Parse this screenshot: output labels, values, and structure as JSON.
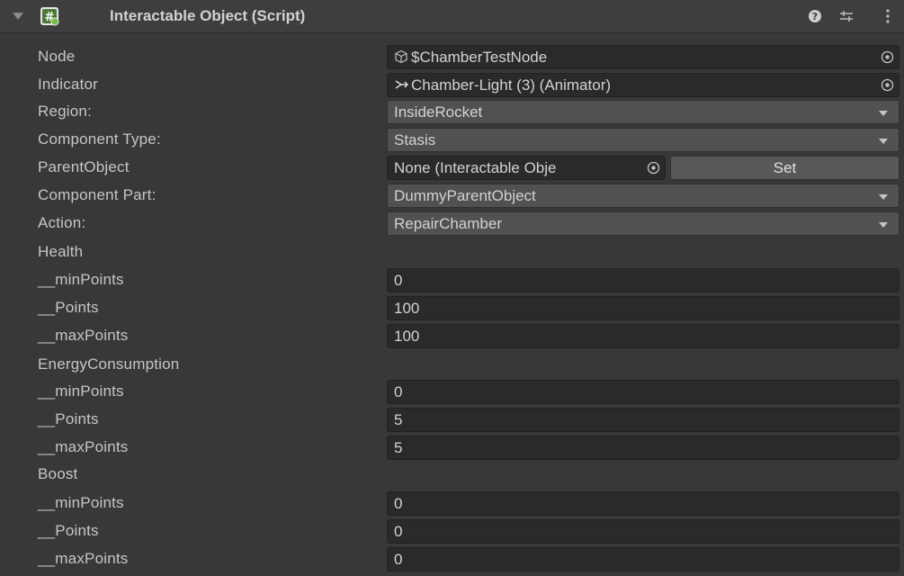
{
  "header": {
    "title": "Interactable Object (Script)"
  },
  "fields": {
    "node": {
      "label": "Node",
      "value": "$ChamberTestNode"
    },
    "indicator": {
      "label": "Indicator",
      "value": "Chamber-Light (3) (Animator)"
    },
    "region": {
      "label": "Region:",
      "value": "InsideRocket"
    },
    "component_type": {
      "label": "Component Type:",
      "value": "Stasis"
    },
    "parent_object": {
      "label": "ParentObject",
      "value": "None (Interactable Obje",
      "button": "Set"
    },
    "component_part": {
      "label": "Component Part:",
      "value": "DummyParentObject"
    },
    "action": {
      "label": "Action:",
      "value": "RepairChamber"
    }
  },
  "groups": {
    "health": {
      "label": "Health",
      "min": {
        "label": "__minPoints",
        "value": "0"
      },
      "points": {
        "label": "__Points",
        "value": "100"
      },
      "max": {
        "label": "__maxPoints",
        "value": "100"
      }
    },
    "energy": {
      "label": "EnergyConsumption",
      "min": {
        "label": "__minPoints",
        "value": "0"
      },
      "points": {
        "label": "__Points",
        "value": "5"
      },
      "max": {
        "label": "__maxPoints",
        "value": "5"
      }
    },
    "boost": {
      "label": "Boost",
      "min": {
        "label": "__minPoints",
        "value": "0"
      },
      "points": {
        "label": "__Points",
        "value": "0"
      },
      "max": {
        "label": "__maxPoints",
        "value": "0"
      }
    }
  },
  "icons": {
    "fold": "fold-arrow-icon",
    "script": "csharp-script-icon",
    "help": "help-icon",
    "presets": "presets-icon",
    "menu": "kebab-menu-icon",
    "picker": "object-picker-icon",
    "node": "cube-icon",
    "animator": "animator-icon"
  },
  "colors": {
    "background": "#383838",
    "header": "#3e3e3e",
    "field": "#2a2a2a",
    "popup": "#515151",
    "button": "#585858",
    "text": "#c6c6c6"
  }
}
